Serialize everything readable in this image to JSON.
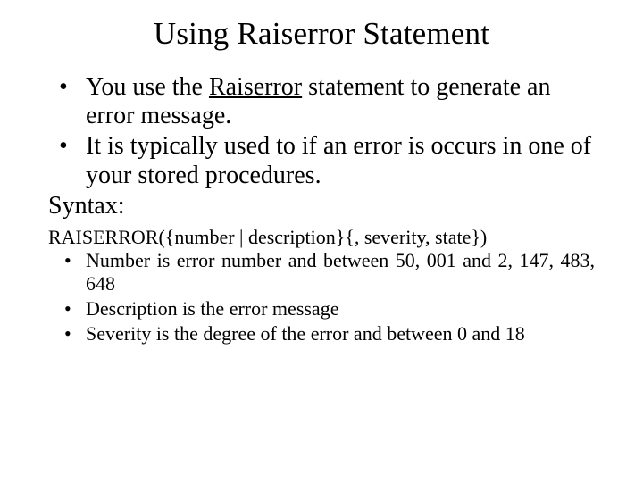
{
  "title": "Using Raiserror Statement",
  "bullets": {
    "b1_pre": "You use the ",
    "b1_underlined": "Raiserror",
    "b1_post": " statement to generate an error message.",
    "b2": "It is typically used to if an error is occurs in one of your stored procedures."
  },
  "syntax_label": "Syntax:",
  "syntax_line": "RAISERROR({number | description}{, severity, state})",
  "sub": {
    "s1": "Number is error number and between 50, 001 and 2, 147, 483, 648",
    "s2": "Description is the error message",
    "s3": "Severity is the degree of the error and between 0 and 18"
  }
}
